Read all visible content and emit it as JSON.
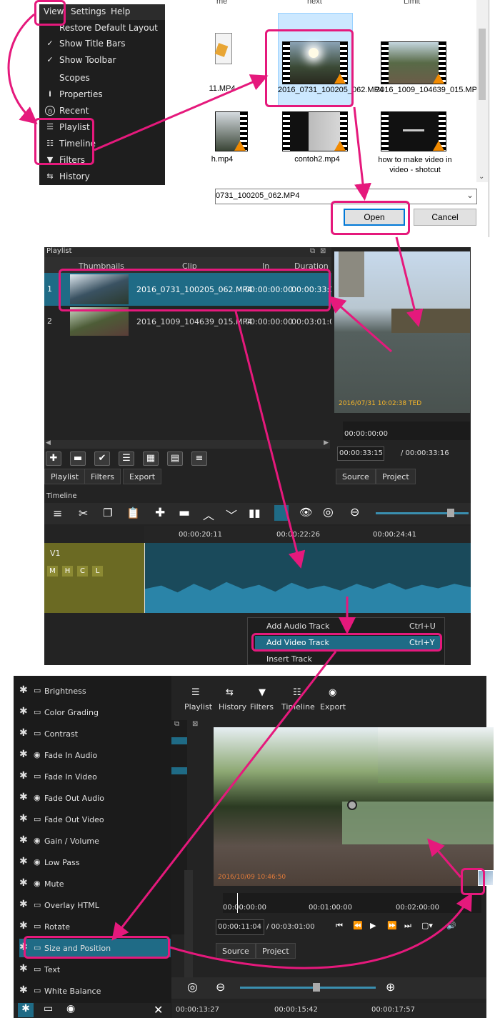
{
  "view_menu": {
    "menubar": [
      "View",
      "Settings",
      "Help"
    ],
    "items": [
      {
        "label": "Restore Default Layout",
        "icon": ""
      },
      {
        "label": "Show Title Bars",
        "icon": "check"
      },
      {
        "label": "Show Toolbar",
        "icon": "check"
      },
      {
        "label": "Scopes",
        "icon": ""
      },
      {
        "label": "Properties",
        "icon": "info"
      },
      {
        "label": "Recent",
        "icon": "clock"
      },
      {
        "label": "Playlist",
        "icon": "list"
      },
      {
        "label": "Timeline",
        "icon": "timeline"
      },
      {
        "label": "Filters",
        "icon": "funnel"
      },
      {
        "label": "History",
        "icon": "history"
      }
    ]
  },
  "file_dialog": {
    "header_cells": [
      "me",
      "next",
      "Limit"
    ],
    "files": [
      {
        "name": "11.MP4"
      },
      {
        "name": "2016_0731_100205_062.MP4"
      },
      {
        "name": "2016_1009_104639_015.MP4"
      },
      {
        "name": "h.mp4"
      },
      {
        "name": "contoh2.mp4"
      },
      {
        "name": "how to make video in video - shotcut"
      }
    ],
    "filename_value": "0731_100205_062.MP4",
    "open_button": "Open",
    "cancel_button": "Cancel"
  },
  "playlist": {
    "title": "Playlist",
    "columns": [
      "Thumbnails",
      "Clip",
      "In",
      "Duration"
    ],
    "rows": [
      {
        "num": "1",
        "clip": "2016_0731_100205_062.MP4",
        "in": "00:00:00:00",
        "duration": "00:00:33:1"
      },
      {
        "num": "2",
        "clip": "2016_1009_104639_015.MP4",
        "in": "00:00:00:00",
        "duration": "00:03:01:0("
      }
    ],
    "tabs": [
      "Playlist",
      "Filters",
      "Export"
    ]
  },
  "viewer": {
    "timestamp": "2016/07/31 10:02:38 TED",
    "ruler_start": "00:00:00:00",
    "current_time": "00:00:33:15",
    "total_time": "/ 00:00:33:16",
    "tabs": [
      "Source",
      "Project"
    ]
  },
  "timeline": {
    "title": "Timeline",
    "ruler_ticks": [
      "00:00:20:11",
      "00:00:22:26",
      "00:00:24:41"
    ],
    "track_name": "V1",
    "track_buttons": [
      "M",
      "H",
      "C",
      "L"
    ]
  },
  "context_menu": {
    "items": [
      {
        "label": "Add Audio Track",
        "shortcut": "Ctrl+U"
      },
      {
        "label": "Add Video Track",
        "shortcut": "Ctrl+Y"
      },
      {
        "label": "Insert Track",
        "shortcut": ""
      }
    ]
  },
  "filters_panel": {
    "items": [
      {
        "label": "Brightness",
        "type": "video"
      },
      {
        "label": "Color Grading",
        "type": "video"
      },
      {
        "label": "Contrast",
        "type": "video"
      },
      {
        "label": "Fade In Audio",
        "type": "audio"
      },
      {
        "label": "Fade In Video",
        "type": "video"
      },
      {
        "label": "Fade Out Audio",
        "type": "audio"
      },
      {
        "label": "Fade Out Video",
        "type": "video"
      },
      {
        "label": "Gain / Volume",
        "type": "audio"
      },
      {
        "label": "Low Pass",
        "type": "audio"
      },
      {
        "label": "Mute",
        "type": "audio"
      },
      {
        "label": "Overlay HTML",
        "type": "video"
      },
      {
        "label": "Rotate",
        "type": "video"
      },
      {
        "label": "Size and Position",
        "type": "video"
      },
      {
        "label": "Text",
        "type": "video"
      },
      {
        "label": "White Balance",
        "type": "video"
      }
    ],
    "toolbar": [
      "Playlist",
      "History",
      "Filters",
      "Timeline",
      "Export"
    ],
    "video_timestamp": "2016/10/09 10:46:50",
    "ruler": [
      "00:00:00:00",
      "00:01:00:00",
      "00:02:00:00"
    ],
    "current_time": "00:00:11:04",
    "total_time": "/ 00:03:01:00",
    "tabs": [
      "Source",
      "Project"
    ],
    "bottom_ruler": [
      "00:00:13:27",
      "00:00:15:42",
      "00:00:17:57"
    ]
  },
  "colors": {
    "accent_pink": "#e5197c",
    "selection_blue": "#1f6b86",
    "track_olive": "#6b6a23"
  }
}
